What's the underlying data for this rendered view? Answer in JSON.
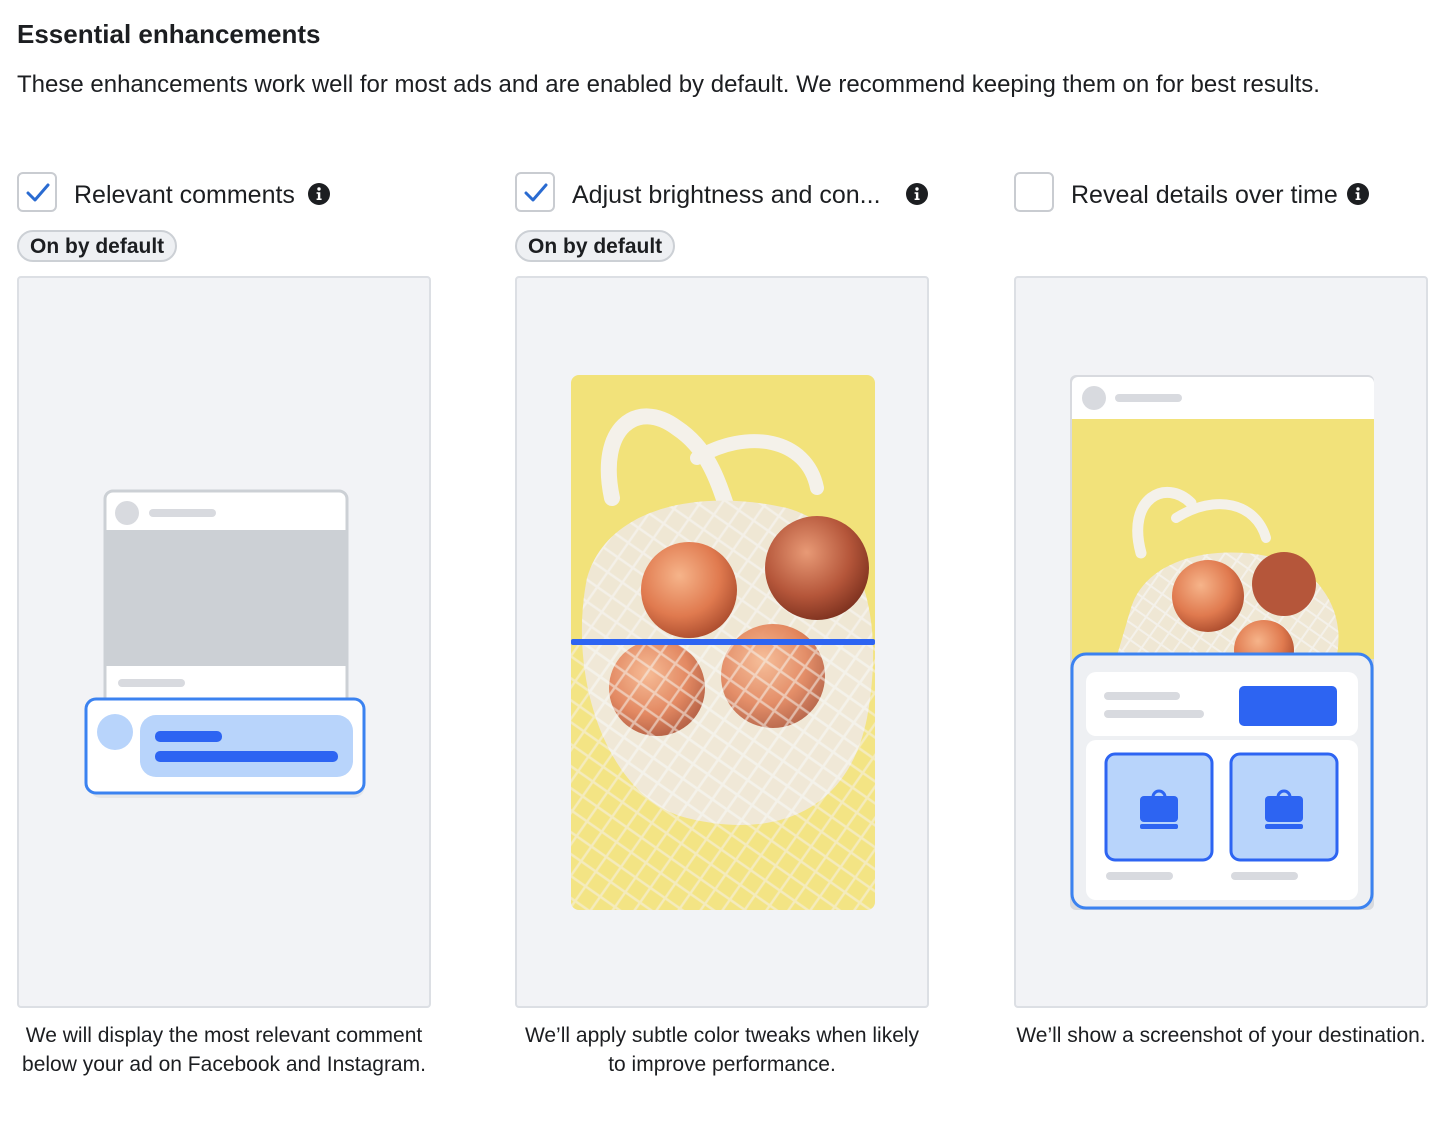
{
  "section": {
    "title": "Essential enhancements",
    "description": "These enhancements work well for most ads and are enabled by default. We recommend keeping them on for best results."
  },
  "options": [
    {
      "label": "Relevant comments",
      "checked": true,
      "badge": "On by default",
      "description": "We will display the most relevant comment below your ad on Facebook and Instagram.",
      "icon": "info-icon"
    },
    {
      "label": "Adjust brightness and con...",
      "checked": true,
      "badge": "On by default",
      "description": "We’ll apply subtle color tweaks when likely to improve performance.",
      "icon": "info-icon"
    },
    {
      "label": "Reveal details over time",
      "checked": false,
      "description": "We’ll show a screenshot of your destination.",
      "icon": "info-icon"
    }
  ],
  "colors": {
    "accent": "#1877f2",
    "check": "#2a6bd1",
    "panel_bg": "#f2f3f6",
    "highlight_blue": "#2d64f2",
    "light_blue": "#b8d4fb",
    "photo_yellow": "#f2e27a"
  }
}
